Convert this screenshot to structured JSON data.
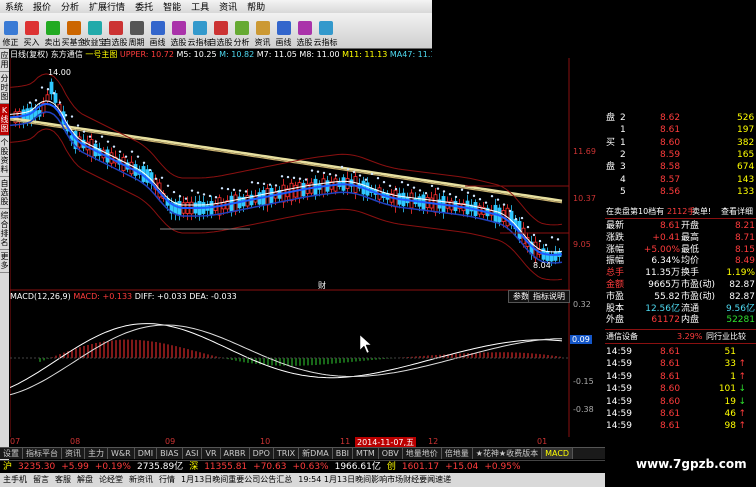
{
  "menu": [
    "系统",
    "报价",
    "分析",
    "扩展行情",
    "委托",
    "智能",
    "工具",
    "资讯",
    "帮助"
  ],
  "toolbar": [
    {
      "label": "修正",
      "color": "#3a7bd5"
    },
    {
      "label": "买入",
      "color": "#d33"
    },
    {
      "label": "卖出",
      "color": "#2a2"
    },
    {
      "label": "买基金",
      "color": "#c60"
    },
    {
      "label": "收益宝",
      "color": "#2aa"
    },
    {
      "label": "自选股",
      "color": "#c33"
    },
    {
      "label": "周期",
      "color": "#555"
    },
    {
      "label": "画线",
      "color": "#36c"
    },
    {
      "label": "选股",
      "color": "#a3a"
    },
    {
      "label": "云指标",
      "color": "#39c"
    },
    {
      "label": "自选股",
      "color": "#c33"
    },
    {
      "label": "分析",
      "color": "#6a3"
    },
    {
      "label": "资讯",
      "color": "#c93"
    },
    {
      "label": "画线",
      "color": "#36c"
    },
    {
      "label": "选股",
      "color": "#a3a"
    },
    {
      "label": "云指标",
      "color": "#39c"
    }
  ],
  "leftbar": [
    "应用",
    "分时图",
    "K线图",
    "个股资料",
    "自选股",
    "综合排名",
    "更多"
  ],
  "chart_title": {
    "name": "日线(复权)",
    "stock": "东方通信",
    "indicator": "一号主图",
    "upper": "UPPER: 10.72",
    "ma5": "M5: 10.25",
    "ma": "M: 10.82",
    "ma7": "M7: 11.05",
    "m8": "M8: 11.00",
    "m11": "M11: 11.13",
    "ma47": "MA47: 11.13"
  },
  "price_axis": [
    "11.69",
    "10.37",
    "9.05"
  ],
  "price_marks": {
    "high": "14.00",
    "low": "8.04"
  },
  "macd_title": {
    "name": "MACD(12,26,9)",
    "macd": "MACD: +0.133",
    "diff": "DIFF: +0.033",
    "dea": "DEA: -0.033"
  },
  "macd_axis": [
    "0.32",
    "0.09",
    "-0.15",
    "-0.38"
  ],
  "macd_highlight": "0.09",
  "buttons": {
    "param": "参数",
    "help": "指标说明",
    "cai": "财"
  },
  "xaxis": [
    {
      "t": "07",
      "p": 0
    },
    {
      "t": "08",
      "p": 60
    },
    {
      "t": "09",
      "p": 155
    },
    {
      "t": "10",
      "p": 250
    },
    {
      "t": "11",
      "p": 330
    },
    {
      "t": "2014-11-07,五",
      "p": 345
    },
    {
      "t": "12",
      "p": 418
    },
    {
      "t": "01",
      "p": 527
    }
  ],
  "tabs": [
    "设置",
    "指标平台",
    "资讯",
    "主力",
    "W&R",
    "DMI",
    "BIAS",
    "ASI",
    "VR",
    "ARBR",
    "DPO",
    "TRIX",
    "新DMA",
    "BBI",
    "MTM",
    "OBV",
    "地量地价",
    "倍地量",
    "★花神★收费版本",
    "MACD"
  ],
  "status1": [
    {
      "t": "沪",
      "c": "yellow"
    },
    {
      "t": "3235.30",
      "c": "red"
    },
    {
      "t": "+5.99",
      "c": "red"
    },
    {
      "t": "+0.19%",
      "c": "red"
    },
    {
      "t": "2735.89亿",
      "c": "white"
    },
    {
      "t": "深",
      "c": "yellow"
    },
    {
      "t": "11355.81",
      "c": "red"
    },
    {
      "t": "+70.63",
      "c": "red"
    },
    {
      "t": "+0.63%",
      "c": "red"
    },
    {
      "t": "1966.61亿",
      "c": "white"
    },
    {
      "t": "创",
      "c": "yellow"
    },
    {
      "t": "1601.17",
      "c": "red"
    },
    {
      "t": "+15.04",
      "c": "red"
    },
    {
      "t": "+0.95%",
      "c": "red"
    }
  ],
  "status2": [
    "主手机",
    "留言",
    "客服",
    "解盘",
    "论经堂",
    "新资讯",
    "行情",
    "1月13日晚间重要公司公告汇总",
    "19:54 1月13日晚间影响市场财经要闻速递"
  ],
  "order_book": [
    {
      "side": "盘",
      "n": "2",
      "price": "8.62",
      "vol": "526",
      "pc": "red"
    },
    {
      "side": "",
      "n": "1",
      "price": "8.61",
      "vol": "197",
      "pc": "red"
    },
    {
      "side": "买",
      "n": "1",
      "price": "8.60",
      "vol": "382",
      "pc": "red"
    },
    {
      "side": "",
      "n": "2",
      "price": "8.59",
      "vol": "165",
      "pc": "red"
    },
    {
      "side": "盘",
      "n": "3",
      "price": "8.58",
      "vol": "674",
      "pc": "red"
    },
    {
      "side": "",
      "n": "4",
      "price": "8.57",
      "vol": "143",
      "pc": "red"
    },
    {
      "side": "",
      "n": "5",
      "price": "8.56",
      "vol": "133",
      "pc": "red"
    }
  ],
  "depth_bar": {
    "title": "在卖盘第10档有",
    "vol": "2112手",
    "sell": "卖单!",
    "btn": "查看详细"
  },
  "quote_rows": [
    {
      "l": "最新",
      "v": "8.61",
      "lc": "white",
      "vc": "red",
      "l2": "开盘",
      "v2": "8.21",
      "v2c": "red"
    },
    {
      "l": "涨跌",
      "v": "+0.41",
      "lc": "white",
      "vc": "red",
      "l2": "最高",
      "v2": "8.71",
      "v2c": "red"
    },
    {
      "l": "涨幅",
      "v": "+5.00%",
      "lc": "white",
      "vc": "red",
      "l2": "最低",
      "v2": "8.15",
      "v2c": "red"
    },
    {
      "l": "振幅",
      "v": "6.34%",
      "lc": "white",
      "vc": "white",
      "l2": "均价",
      "v2": "8.49",
      "v2c": "red"
    },
    {
      "l": "总手",
      "v": "11.35万",
      "lc": "red",
      "vc": "white",
      "l2": "换手",
      "v2": "1.19%",
      "v2c": "yellow"
    },
    {
      "l": "金额",
      "v": "9665万",
      "lc": "red",
      "vc": "white",
      "l2": "市盈(动)",
      "v2": "82.87",
      "v2c": "white"
    },
    {
      "l": "市盈",
      "v": "55.82",
      "lc": "white",
      "vc": "white",
      "l2": "市盈(动)",
      "v2": "82.87",
      "v2c": "white"
    },
    {
      "l": "股本",
      "v": "12.56亿",
      "lc": "white",
      "vc": "cyan",
      "l2": "流通",
      "v2": "9.56亿",
      "v2c": "cyan"
    },
    {
      "l": "外盘",
      "v": "61172",
      "lc": "white",
      "vc": "red",
      "l2": "内盘",
      "v2": "52281",
      "v2c": "green"
    }
  ],
  "sector": {
    "name": "通信设备",
    "pct": "3.29%",
    "btn": "同行业比较"
  },
  "ticks": [
    {
      "t": "14:59",
      "p": "8.61",
      "v": "51",
      "d": "",
      "dc": "red"
    },
    {
      "t": "14:59",
      "p": "8.61",
      "v": "33",
      "d": "↑",
      "dc": "red"
    },
    {
      "t": "14:59",
      "p": "8.61",
      "v": "1",
      "d": "↑",
      "dc": "red"
    },
    {
      "t": "14:59",
      "p": "8.60",
      "v": "101",
      "d": "↓",
      "dc": "green"
    },
    {
      "t": "14:59",
      "p": "8.60",
      "v": "19",
      "d": "↓",
      "dc": "green"
    },
    {
      "t": "14:59",
      "p": "8.61",
      "v": "46",
      "d": "↑",
      "dc": "red"
    },
    {
      "t": "14:59",
      "p": "8.61",
      "v": "98",
      "d": "↑",
      "dc": "red"
    }
  ],
  "watermark": "www.7gpzb.com"
}
